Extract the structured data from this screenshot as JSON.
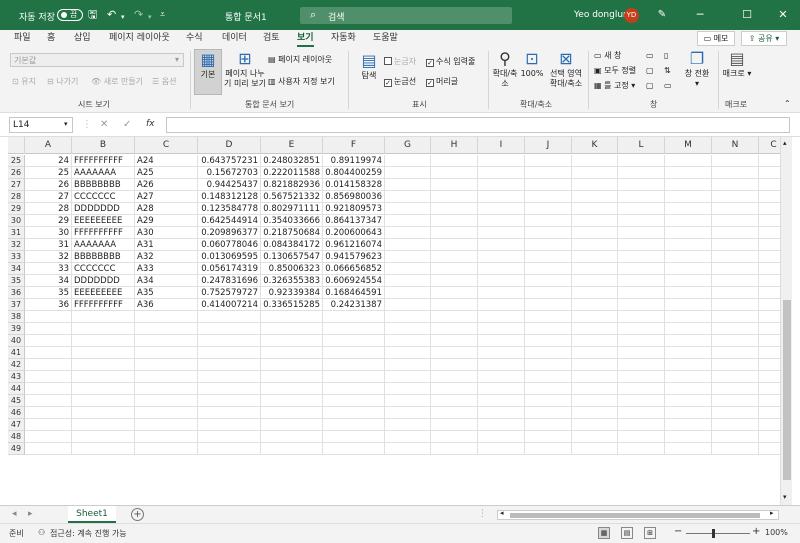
{
  "title_bar": {
    "autosave_label": "자동 저장",
    "autosave_state": "끔",
    "save_icon": "save-icon",
    "undo_icon": "undo-icon",
    "redo_icon": "redo-icon",
    "customize_icon": "customize-qat-icon",
    "doc_title": "통합 문서1",
    "search_placeholder": "검색",
    "user_name": "Yeo donglun",
    "user_initials": "YD",
    "window_buttons": [
      "─",
      "☐",
      "✕"
    ]
  },
  "ribbon_tabs": [
    "파일",
    "홈",
    "삽입",
    "페이지 레이아웃",
    "수식",
    "데이터",
    "검토",
    "보기",
    "자동화",
    "도움말"
  ],
  "active_tab": "보기",
  "memo_label": "메모",
  "share_label": "공유",
  "ribbon": {
    "sheet_view": {
      "combo_value": "기본값",
      "keep": "유지",
      "exit": "나가기",
      "new": "새로 만들기",
      "options": "옵션",
      "label": "시트 보기"
    },
    "workbook_views": {
      "normal": "기본",
      "page_break": "페이지 나누기 미리 보기",
      "page_layout": "페이지 레이아웃",
      "custom": "사용자 지정 보기",
      "label": "통합 문서 보기"
    },
    "show": {
      "navigation": "탐색",
      "ruler": "눈금자",
      "formula_bar": "수식 입력줄",
      "gridlines": "눈금선",
      "headings": "머리글",
      "label": "표시"
    },
    "zoom": {
      "zoom": "확대/축소",
      "hundred": "100%",
      "selection": "선택 영역 확대/축소",
      "label": "확대/축소"
    },
    "window": {
      "new_window": "새 창",
      "arrange_all": "모두 정렬",
      "freeze": "틀 고정",
      "switch": "창 전환",
      "label": "창"
    },
    "macros": {
      "macro": "매크로",
      "label": "매크로"
    }
  },
  "formula_bar": {
    "name_box": "L14",
    "cancel": "✕",
    "enter": "✓",
    "fx": "fx",
    "content": ""
  },
  "columns": [
    "A",
    "B",
    "C",
    "D",
    "E",
    "F",
    "G",
    "H",
    "I",
    "J",
    "K",
    "L",
    "M",
    "N",
    "C"
  ],
  "rows": [
    {
      "n": "25",
      "a": "24",
      "b": "FFFFFFFFFF",
      "c": "A24",
      "d": "0.643757231",
      "e": "0.248032851",
      "f": "0.89119974"
    },
    {
      "n": "26",
      "a": "25",
      "b": "AAAAAAA",
      "c": "A25",
      "d": "0.15672703",
      "e": "0.222011588",
      "f": "0.804400259"
    },
    {
      "n": "27",
      "a": "26",
      "b": "BBBBBBBB",
      "c": "A26",
      "d": "0.94425437",
      "e": "0.821882936",
      "f": "0.014158328"
    },
    {
      "n": "28",
      "a": "27",
      "b": "CCCCCCC",
      "c": "A27",
      "d": "0.148312128",
      "e": "0.567521332",
      "f": "0.856980036"
    },
    {
      "n": "29",
      "a": "28",
      "b": "DDDDDDD",
      "c": "A28",
      "d": "0.123584778",
      "e": "0.802971111",
      "f": "0.921809573"
    },
    {
      "n": "30",
      "a": "29",
      "b": "EEEEEEEEE",
      "c": "A29",
      "d": "0.642544914",
      "e": "0.354033666",
      "f": "0.864137347"
    },
    {
      "n": "31",
      "a": "30",
      "b": "FFFFFFFFFF",
      "c": "A30",
      "d": "0.209896377",
      "e": "0.218750684",
      "f": "0.200600643"
    },
    {
      "n": "32",
      "a": "31",
      "b": "AAAAAAA",
      "c": "A31",
      "d": "0.060778046",
      "e": "0.084384172",
      "f": "0.961216074"
    },
    {
      "n": "33",
      "a": "32",
      "b": "BBBBBBBB",
      "c": "A32",
      "d": "0.013069595",
      "e": "0.130657547",
      "f": "0.941579623"
    },
    {
      "n": "34",
      "a": "33",
      "b": "CCCCCCC",
      "c": "A33",
      "d": "0.056174319",
      "e": "0.85006323",
      "f": "0.066656852"
    },
    {
      "n": "35",
      "a": "34",
      "b": "DDDDDDD",
      "c": "A34",
      "d": "0.247831696",
      "e": "0.326355383",
      "f": "0.606924554"
    },
    {
      "n": "36",
      "a": "35",
      "b": "EEEEEEEEE",
      "c": "A35",
      "d": "0.752579727",
      "e": "0.92339384",
      "f": "0.168464591"
    },
    {
      "n": "37",
      "a": "36",
      "b": "FFFFFFFFFF",
      "c": "A36",
      "d": "0.414007214",
      "e": "0.336515285",
      "f": "0.24231387"
    },
    {
      "n": "38"
    },
    {
      "n": "39"
    },
    {
      "n": "40"
    },
    {
      "n": "41"
    },
    {
      "n": "42"
    },
    {
      "n": "43"
    },
    {
      "n": "44"
    },
    {
      "n": "45"
    },
    {
      "n": "46"
    },
    {
      "n": "47"
    },
    {
      "n": "48"
    },
    {
      "n": "49"
    }
  ],
  "sheet_tab": "Sheet1",
  "add_sheet": "+",
  "status": {
    "ready": "준비",
    "accessibility": "접근성: 계속 진행 가능",
    "zoom": "100%",
    "minus": "−",
    "plus": "+"
  },
  "colors": {
    "excel_green": "#217346",
    "avatar": "#c43e1c"
  }
}
